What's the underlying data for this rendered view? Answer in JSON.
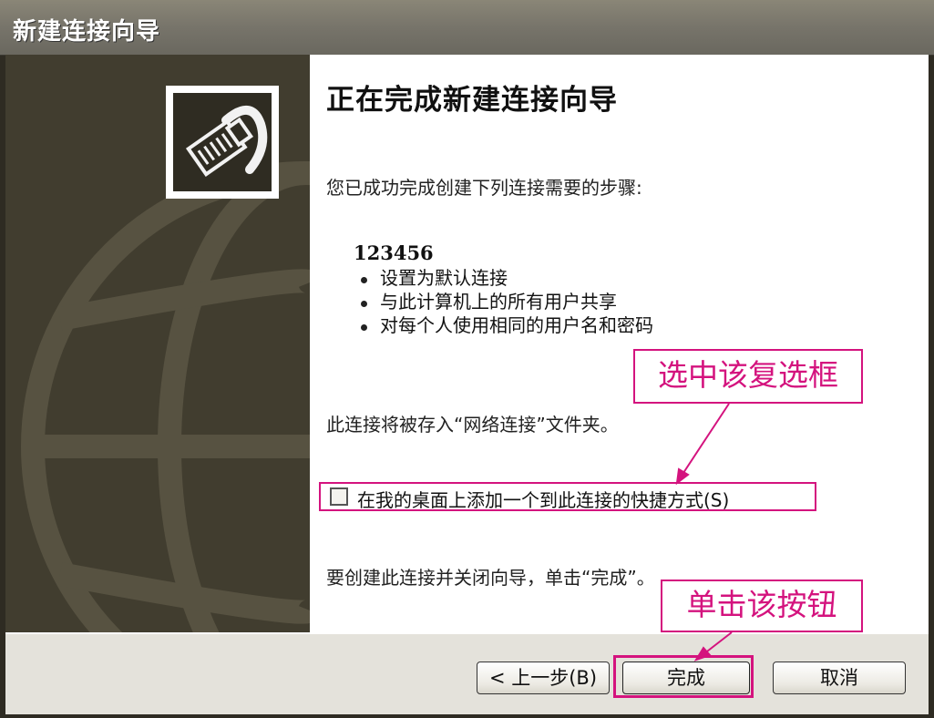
{
  "window": {
    "title": "新建连接向导"
  },
  "content": {
    "heading": "正在完成新建连接向导",
    "intro": "您已成功完成创建下列连接需要的步骤:",
    "connection_name": "123456",
    "bullets": [
      "设置为默认连接",
      "与此计算机上的所有用户共享",
      "对每个人使用相同的用户名和密码"
    ],
    "store_note": "此连接将被存入“网络连接”文件夹。",
    "shortcut_checkbox": {
      "label": "在我的桌面上添加一个到此连接的快捷方式(S)",
      "checked": false
    },
    "finish_note": "要创建此连接并关闭向导，单击“完成”。"
  },
  "buttons": {
    "back_label": "< 上一步(B)",
    "finish_label": "完成",
    "cancel_label": "取消"
  },
  "annotations": {
    "callout_checkbox": "选中该复选框",
    "callout_button": "单击该按钮"
  },
  "icons": {
    "logo": "network-cable-icon"
  },
  "colors": {
    "annotation": "#d4137e",
    "side_panel": "#413d2f",
    "titlebar": "#7a776d"
  }
}
